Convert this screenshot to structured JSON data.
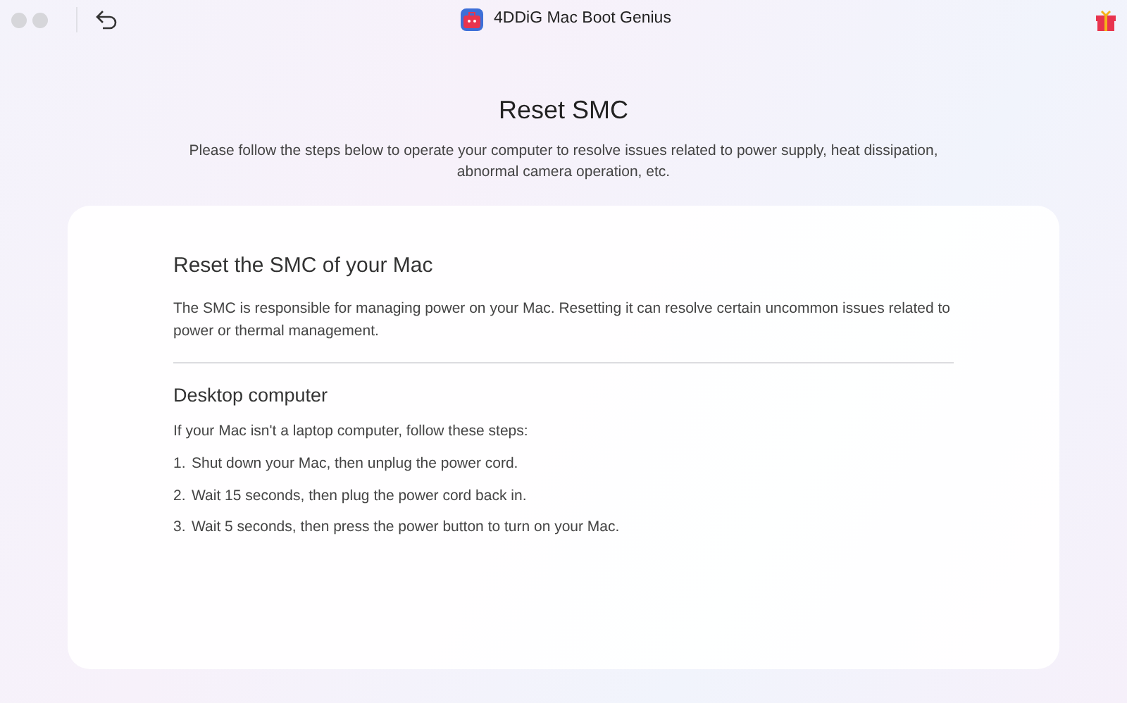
{
  "window": {
    "title": "4DDiG Mac Boot Genius"
  },
  "page": {
    "title": "Reset SMC",
    "subtitle": "Please follow the steps below to operate your computer to resolve issues related to power supply, heat dissipation, abnormal camera operation, etc."
  },
  "card": {
    "heading": "Reset the SMC of your Mac",
    "intro": "The SMC is responsible for managing power on your Mac. Resetting it can resolve certain uncommon issues related to power or thermal management.",
    "section": {
      "heading": "Desktop computer",
      "lead": "If your Mac isn't a laptop computer, follow these steps:",
      "steps": [
        {
          "number": "1.",
          "text": "Shut down your Mac, then unplug the power cord."
        },
        {
          "number": "2.",
          "text": "Wait 15 seconds, then plug the power cord back in."
        },
        {
          "number": "3.",
          "text": "Wait 5 seconds, then press the power button to turn on your Mac."
        }
      ]
    }
  }
}
